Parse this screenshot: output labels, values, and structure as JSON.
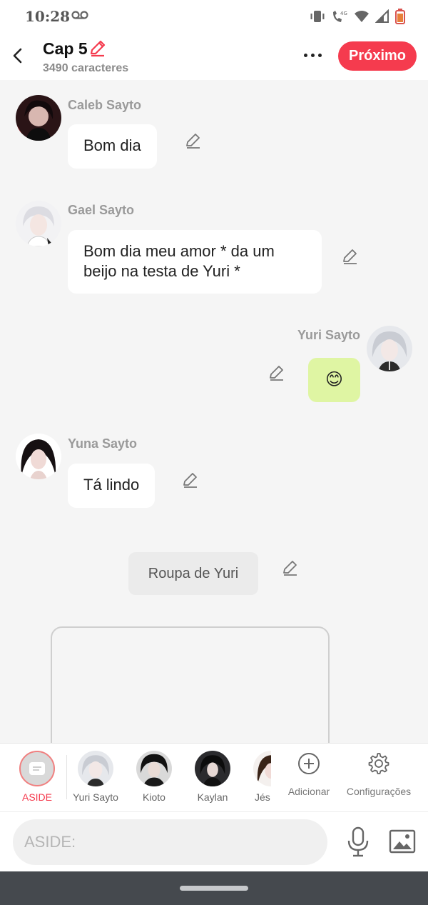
{
  "status_bar": {
    "time": "10:28"
  },
  "header": {
    "chapter_title": "Cap 5",
    "char_count": "3490 caracteres",
    "next_label": "Próximo",
    "accent_color": "#f53b4e"
  },
  "messages": [
    {
      "sender": "Caleb Sayto",
      "text": "Bom dia",
      "side": "left"
    },
    {
      "sender": "Gael Sayto",
      "text": "Bom dia meu amor * da um beijo na testa de Yuri *",
      "side": "left"
    },
    {
      "sender": "Yuri Sayto",
      "text": "😊",
      "side": "right"
    },
    {
      "sender": "Yuna Sayto",
      "text": "Tá lindo",
      "side": "left"
    }
  ],
  "aside_message": {
    "text": "Roupa de Yuri"
  },
  "character_bar": {
    "items": [
      {
        "label": "ASIDE",
        "active": true
      },
      {
        "label": "Yuri Sayto"
      },
      {
        "label": "Kioto"
      },
      {
        "label": "Kaylan"
      },
      {
        "label": "Jés"
      }
    ],
    "add_label": "Adicionar",
    "settings_label": "Configurações"
  },
  "input": {
    "placeholder": "ASIDE:"
  }
}
